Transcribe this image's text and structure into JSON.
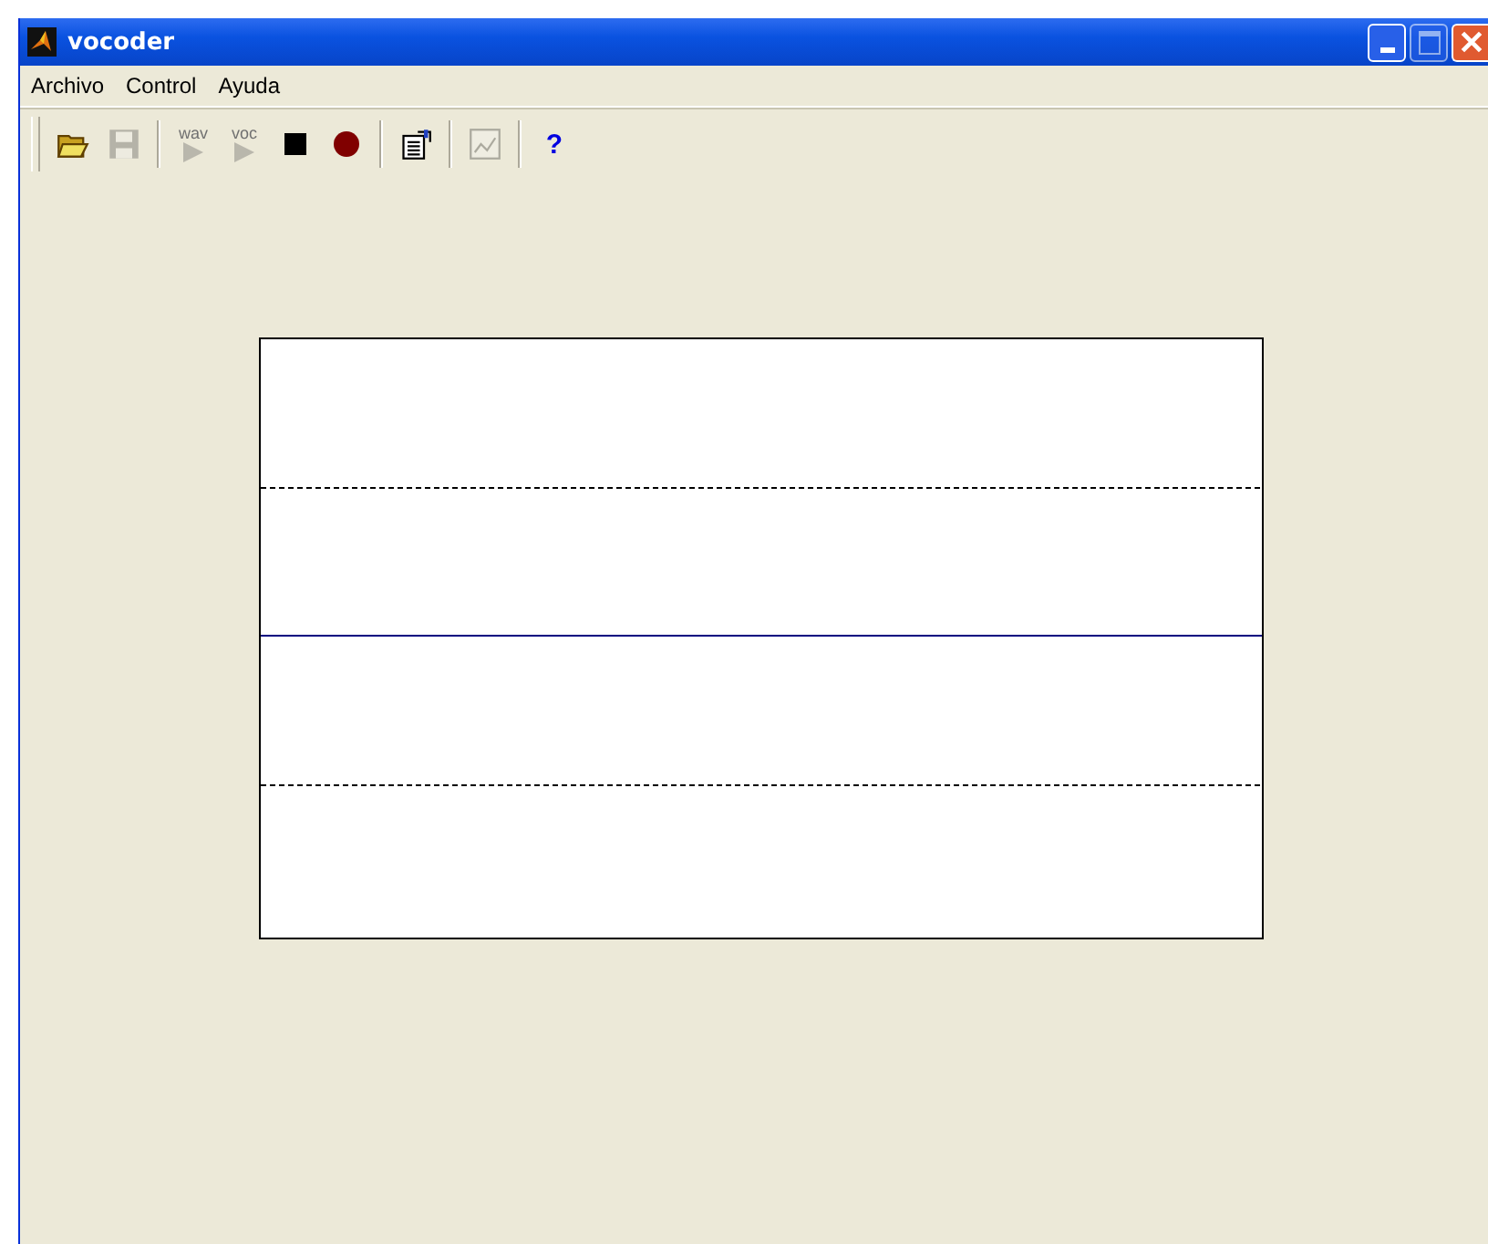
{
  "window": {
    "title": "vocoder",
    "maximize_disabled": true
  },
  "menu": [
    "Archivo",
    "Control",
    "Ayuda"
  ],
  "toolbar": [
    {
      "kind": "open",
      "disabled": false
    },
    {
      "kind": "save",
      "disabled": true
    },
    {
      "kind": "separator"
    },
    {
      "kind": "play",
      "label": "wav",
      "disabled": true
    },
    {
      "kind": "play",
      "label": "voc",
      "disabled": true
    },
    {
      "kind": "stop",
      "disabled": false
    },
    {
      "kind": "record",
      "disabled": false
    },
    {
      "kind": "separator"
    },
    {
      "kind": "properties",
      "disabled": false
    },
    {
      "kind": "separator"
    },
    {
      "kind": "plot",
      "disabled": true
    },
    {
      "kind": "separator"
    },
    {
      "kind": "help",
      "label": "?",
      "disabled": false
    }
  ]
}
